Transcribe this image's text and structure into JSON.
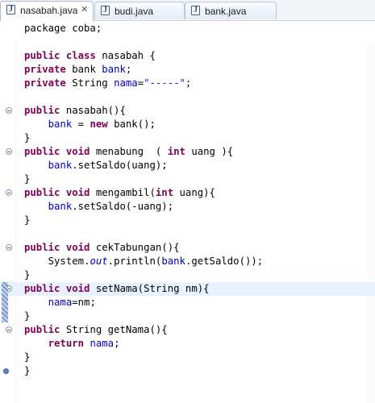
{
  "tabs": [
    {
      "label": "nasabah.java",
      "active": true,
      "close": "✕",
      "icon": "java-file-icon"
    },
    {
      "label": "budi.java",
      "active": false,
      "icon": "java-file-icon"
    },
    {
      "label": "bank.java",
      "active": false,
      "icon": "java-file-icon"
    }
  ],
  "icon_letter": "J",
  "code": {
    "l1": [
      "package coba;"
    ],
    "l3": [
      "public",
      "class",
      "nasabah {"
    ],
    "l4": [
      "private",
      "bank ",
      "bank",
      ";"
    ],
    "l5": [
      "private",
      "String ",
      "nama",
      "=",
      "\"-----\"",
      ";"
    ],
    "l7": [
      "public",
      "nasabah(){"
    ],
    "l8": [
      "bank",
      " = ",
      "new",
      "bank();"
    ],
    "l9": [
      "}"
    ],
    "l10": [
      "public",
      "void",
      "menabung  ( ",
      "int",
      "uang ){"
    ],
    "l11": [
      "bank",
      ".setSaldo(uang);"
    ],
    "l12": [
      "}"
    ],
    "l13": [
      "public",
      "void",
      "mengambil(",
      "int",
      "uang){"
    ],
    "l14": [
      "bank",
      ".setSaldo(-uang);"
    ],
    "l15": [
      "}"
    ],
    "l17": [
      "public",
      "void",
      "cekTabungan(){"
    ],
    "l18": [
      "System.",
      "out",
      ".println(",
      "bank",
      ".getSaldo());"
    ],
    "l19": [
      "}"
    ],
    "l20": [
      "public",
      "void",
      "setNama(String nm){"
    ],
    "l21": [
      "nama",
      "=nm;"
    ],
    "l22": [
      "}"
    ],
    "l23": [
      "public",
      "String getNama(){"
    ],
    "l24": [
      "return",
      "nama",
      ";"
    ],
    "l25": [
      "}"
    ],
    "l26": [
      "}"
    ]
  },
  "colors": {
    "keyword": "#7f0055",
    "field": "#0000c0",
    "string": "#2a00ff",
    "current_line": "#e8f2fe"
  }
}
